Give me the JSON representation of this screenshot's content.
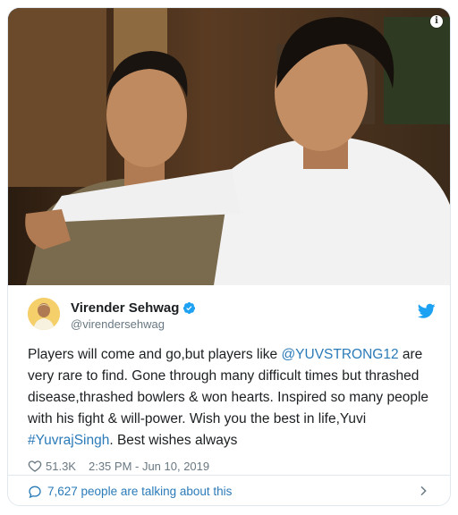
{
  "tweet": {
    "author_name": "Virender Sehwag",
    "author_handle": "@virendersehwag",
    "text_part1": "Players will come and go,but players like ",
    "mention": "@YUVSTRONG12",
    "text_part2": " are very rare to find. Gone through many difficult times but thrashed disease,thrashed bowlers & won hearts. Inspired so many people with his fight & will-power. Wish you the best in life,Yuvi ",
    "hashtag": "#YuvrajSingh",
    "text_part3": ". Best wishes always",
    "likes": "51.3K",
    "timestamp": "2:35 PM - Jun 10, 2019"
  },
  "footer": {
    "conversation_label": "7,627 people are talking about this"
  },
  "icons": {
    "info": "info-icon",
    "verified": "verified-badge-icon",
    "brand": "twitter-bird-icon",
    "like": "heart-icon",
    "conversation": "speech-bubble-icon",
    "more": "chevron-right-icon"
  },
  "colors": {
    "link": "#2b7bb9",
    "verified": "#1da1f2",
    "muted": "#697882",
    "text": "#1c2022",
    "border": "#e1e8ed"
  },
  "info_glyph": "i"
}
